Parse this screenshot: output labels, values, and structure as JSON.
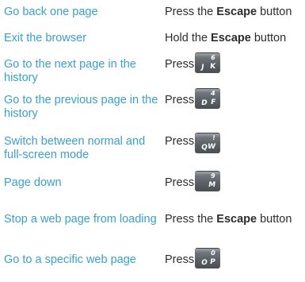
{
  "rows": [
    {
      "action": "Go back one page",
      "instr_pre": "Press the ",
      "instr_bold": "Escape",
      "instr_post": " button"
    },
    {
      "action": "Exit the browser",
      "instr_pre": "Hold the ",
      "instr_bold": "Escape",
      "instr_post": " button"
    },
    {
      "action": "Go to the next page in the history",
      "instr": "Press",
      "key_icon": "6-jk-key-icon",
      "key": {
        "top": "6",
        "left": "J",
        "right": "K"
      }
    },
    {
      "action": "Go to the previous page in the history",
      "instr": "Press",
      "key_icon": "4-df-key-icon",
      "key": {
        "top": "4",
        "left": "D",
        "right": "F"
      }
    },
    {
      "action": "Switch between normal and full-screen mode",
      "instr": "Press",
      "key_icon": "exclaim-qw-key-icon",
      "key": {
        "top": "!",
        "left": "Q",
        "right": "W"
      }
    },
    {
      "action": "Page down",
      "instr": "Press",
      "key_icon": "9-m-key-icon",
      "key": {
        "top": "9",
        "left": "",
        "right": "M"
      }
    },
    {
      "action": "Stop a web page from loading",
      "instr_pre": "Press the ",
      "instr_bold": "Escape",
      "instr_post": " button"
    },
    {
      "action": "Go to a specific web page",
      "instr": "Press",
      "key_icon": "0-op-key-icon",
      "key": {
        "top": "0",
        "left": "O",
        "right": "P"
      }
    }
  ],
  "colors": {
    "action": "#3aa0c8",
    "instruction": "#2d2d2d",
    "key": "#5b6166"
  }
}
